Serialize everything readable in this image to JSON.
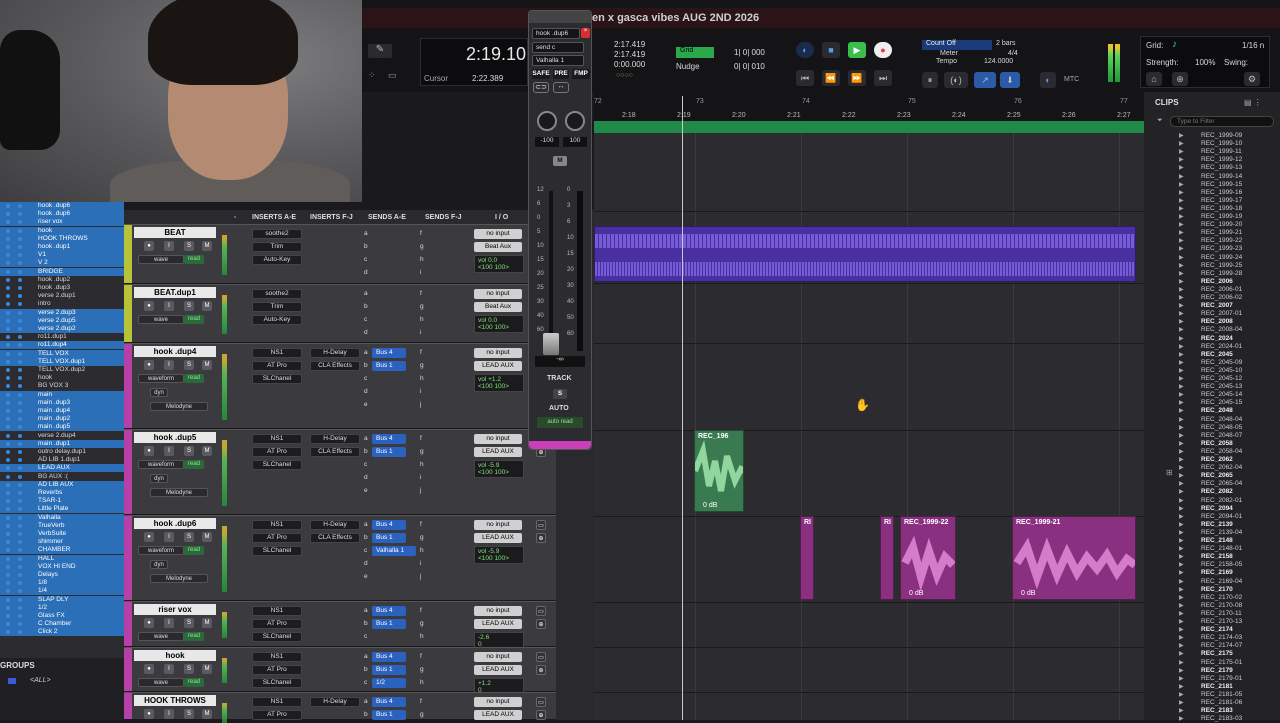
{
  "session": {
    "title": "en x gasca vibes AUG 2ND 2026"
  },
  "transport": {
    "counter_main": "2:19.10",
    "cursor_label": "Cursor",
    "cursor_value": "2:22.389",
    "sel_start": "2:17.419",
    "sel_end": "2:17.419",
    "sel_length": "0:00.000",
    "grid_label": "Grid",
    "grid_value": "1| 0| 000",
    "nudge_label": "Nudge",
    "nudge_value": "0| 0| 010",
    "count_off": "Count Off",
    "count_off_value": "2 bars",
    "meter_label": "Meter",
    "meter_value": "4/4",
    "tempo_label": "Tempo",
    "tempo_value": "124.0000",
    "mtc": "MTC",
    "grid2_label": "Grid:",
    "grid2_value": "1/16 n",
    "strength_label": "Strength:",
    "strength_value": "100%",
    "swing_label": "Swing:"
  },
  "ruler": {
    "bars": [
      "72",
      "73",
      "74",
      "75",
      "76",
      "77"
    ],
    "times": [
      "2:18",
      "2:19",
      "2:20",
      "2:21",
      "2:22",
      "2:23",
      "2:24",
      "2:25",
      "2:26",
      "2:27"
    ]
  },
  "tracks_list": [
    {
      "name": "hook .dup6",
      "hl": true
    },
    {
      "name": "hook .dup6",
      "hl": true
    },
    {
      "name": "riser vox",
      "hl": true
    },
    {
      "name": "hook",
      "hl": true
    },
    {
      "name": "HOOK THROWS",
      "hl": true
    },
    {
      "name": "hook .dup1",
      "hl": true
    },
    {
      "name": "V1",
      "hl": true
    },
    {
      "name": "V 2",
      "hl": true
    },
    {
      "name": "BRIDGE",
      "hl": true
    },
    {
      "name": "hook .dup2",
      "hl": false
    },
    {
      "name": "hook .dup3",
      "hl": false
    },
    {
      "name": "verse 2.dup1",
      "hl": false
    },
    {
      "name": "intro",
      "hl": false
    },
    {
      "name": "verse 2.dup3",
      "hl": true
    },
    {
      "name": "verse 2.dup5",
      "hl": true
    },
    {
      "name": "verse 2.dup2",
      "hl": true
    },
    {
      "name": "ro11.dup1",
      "hl": false
    },
    {
      "name": "ro11.dup4",
      "hl": true
    },
    {
      "name": "TELL VOX",
      "hl": true
    },
    {
      "name": "TELL VOX.dup1",
      "hl": true
    },
    {
      "name": "TELL VOX.dup2",
      "hl": false
    },
    {
      "name": "hook",
      "hl": false
    },
    {
      "name": "BG VOX 3",
      "hl": false
    },
    {
      "name": "main",
      "hl": true
    },
    {
      "name": "main .dup3",
      "hl": true
    },
    {
      "name": "main .dup4",
      "hl": true
    },
    {
      "name": "main .dup2",
      "hl": true
    },
    {
      "name": "main .dup5",
      "hl": true
    },
    {
      "name": "verse 2.dup4",
      "hl": false
    },
    {
      "name": "main .dup1",
      "hl": true
    },
    {
      "name": "outro delay.dup1",
      "hl": false
    },
    {
      "name": "AD LIB 1.dup1",
      "hl": false
    },
    {
      "name": "LEAD AUX",
      "hl": true
    },
    {
      "name": "BG AUX :(",
      "hl": false
    },
    {
      "name": "AD LIB AUX",
      "hl": true
    },
    {
      "name": "Reverbs",
      "hl": true
    },
    {
      "name": "TSAR-1",
      "hl": true
    },
    {
      "name": "Little Plate",
      "hl": true
    },
    {
      "name": "Valhalla",
      "hl": true
    },
    {
      "name": "TrueVerb",
      "hl": true
    },
    {
      "name": "VerbSuite",
      "hl": true
    },
    {
      "name": "shimmer",
      "hl": true
    },
    {
      "name": "CHAMBER",
      "hl": true
    },
    {
      "name": "HALL",
      "hl": true
    },
    {
      "name": "VOX HI END",
      "hl": true
    },
    {
      "name": "Delays",
      "hl": true
    },
    {
      "name": "1/8",
      "hl": true
    },
    {
      "name": "1/4",
      "hl": true
    },
    {
      "name": "SLAP DLY",
      "hl": true
    },
    {
      "name": "1/2",
      "hl": true
    },
    {
      "name": "Glass FX",
      "hl": true
    },
    {
      "name": "C Chamber",
      "hl": true
    },
    {
      "name": "Click 2",
      "hl": true
    }
  ],
  "groups": {
    "label": "GROUPS",
    "all": "<ALL>"
  },
  "mix_headers": {
    "inserts_ae": "INSERTS A-E",
    "inserts_fj": "INSERTS F-J",
    "sends_ae": "SENDS A-E",
    "sends_fj": "SENDS F-J",
    "io": "I / O"
  },
  "mix_tracks": [
    {
      "name": "BEAT",
      "ins1": [
        "soothe2",
        "Trim",
        "Auto-Key"
      ],
      "ins2": [],
      "sends": [],
      "io_in": "no input",
      "io_out": "Beat Aux",
      "vol": "vol 0.0",
      "pan": "<100   100>",
      "mode": "wave",
      "auto": "read",
      "dyn": false,
      "color": "#b7c43a"
    },
    {
      "name": "BEAT.dup1",
      "ins1": [
        "soothe2",
        "Trim",
        "Auto-Key"
      ],
      "ins2": [],
      "sends": [],
      "io_in": "no input",
      "io_out": "Beat Aux",
      "vol": "vol 0.0",
      "pan": "<100   100>",
      "mode": "wave",
      "auto": "read",
      "dyn": false,
      "color": "#b7c43a"
    },
    {
      "name": "hook .dup4",
      "ins1": [
        "NS1",
        "AT Pro",
        "SLChanel"
      ],
      "ins2": [
        "H-Delay",
        "CLA Effects"
      ],
      "sends": [
        "Bus 4",
        "Bus 1"
      ],
      "io_in": "no input",
      "io_out": "LEAD AUX",
      "vol": "vol +1.2",
      "pan": "<100   100>",
      "mode": "waveform",
      "auto": "read",
      "dyn": true,
      "plugin": "Melodyne",
      "color": "#b640a8"
    },
    {
      "name": "hook .dup5",
      "ins1": [
        "NS1",
        "AT Pro",
        "SLChanel"
      ],
      "ins2": [
        "H-Delay",
        "CLA Effects"
      ],
      "sends": [
        "Bus 4",
        "Bus 1"
      ],
      "io_in": "no input",
      "io_out": "LEAD AUX",
      "vol": "vol -5.9",
      "pan": "<100   100>",
      "mode": "waveform",
      "auto": "read",
      "dyn": true,
      "plugin": "Melodyne",
      "color": "#b640a8"
    },
    {
      "name": "hook .dup6",
      "ins1": [
        "NS1",
        "AT Pro",
        "SLChanel"
      ],
      "ins2": [
        "H-Delay",
        "CLA Effects"
      ],
      "sends": [
        "Bus 4",
        "Bus 1",
        "Valhalla 1"
      ],
      "io_in": "no input",
      "io_out": "LEAD AUX",
      "vol": "vol -5.9",
      "pan": "<100   100>",
      "mode": "waveform",
      "auto": "read",
      "dyn": true,
      "plugin": "Melodyne",
      "color": "#b640a8"
    },
    {
      "name": "riser vox",
      "ins1": [
        "NS1",
        "AT Pro",
        "SLChanel"
      ],
      "ins2": [],
      "sends": [
        "Bus 4",
        "Bus 1"
      ],
      "io_in": "no input",
      "io_out": "LEAD AUX",
      "vol": "-2.6",
      "pan": "0",
      "mode": "wave",
      "auto": "read",
      "dyn": false,
      "color": "#b640a8"
    },
    {
      "name": "hook",
      "ins1": [
        "NS1",
        "AT Pro",
        "SLChanel"
      ],
      "ins2": [],
      "sends": [
        "Bus 4",
        "Bus 1",
        "1/2"
      ],
      "io_in": "no input",
      "io_out": "LEAD AUX",
      "vol": "+1.2",
      "pan": "0",
      "mode": "wave",
      "auto": "read",
      "dyn": false,
      "color": "#b640a8"
    },
    {
      "name": "HOOK THROWS",
      "ins1": [
        "NS1",
        "AT Pro"
      ],
      "ins2": [
        "H-Delay"
      ],
      "sends": [
        "Bus 4",
        "Bus 1"
      ],
      "io_in": "no input",
      "io_out": "LEAD AUX",
      "vol": "",
      "pan": "",
      "mode": "wave",
      "auto": "read",
      "dyn": false,
      "color": "#b640a8"
    }
  ],
  "channel_strip": {
    "track": "hook .dup6",
    "send": "send c",
    "plugin": "Valhalla 1",
    "safe": "SAFE",
    "pre": "PRE",
    "fmp": "FMP",
    "pan_l": "-100",
    "pan_r": "100",
    "m": "M",
    "vol": "-∞",
    "track_label": "TRACK",
    "s": "S",
    "auto_label": "AUTO",
    "auto_mode": "auto read",
    "scale": [
      "12",
      "6",
      "0",
      "5",
      "10",
      "15",
      "20",
      "25",
      "30",
      "40",
      "60"
    ],
    "meter_scale": [
      "0",
      "3",
      "6",
      "10",
      "15",
      "20",
      "30",
      "40",
      "50",
      "60"
    ]
  },
  "clips_panel": {
    "header": "CLIPS",
    "filter_placeholder": "Type to Filter",
    "items": [
      {
        "name": "REC_1999-09",
        "bold": false
      },
      {
        "name": "REC_1999-10",
        "bold": false
      },
      {
        "name": "REC_1999-11",
        "bold": false
      },
      {
        "name": "REC_1999-12",
        "bold": false
      },
      {
        "name": "REC_1999-13",
        "bold": false
      },
      {
        "name": "REC_1999-14",
        "bold": false
      },
      {
        "name": "REC_1999-15",
        "bold": false
      },
      {
        "name": "REC_1999-16",
        "bold": false
      },
      {
        "name": "REC_1999-17",
        "bold": false
      },
      {
        "name": "REC_1999-18",
        "bold": false
      },
      {
        "name": "REC_1999-19",
        "bold": false
      },
      {
        "name": "REC_1999-20",
        "bold": false
      },
      {
        "name": "REC_1999-21",
        "bold": false
      },
      {
        "name": "REC_1999-22",
        "bold": false
      },
      {
        "name": "REC_1999-23",
        "bold": false
      },
      {
        "name": "REC_1999-24",
        "bold": false
      },
      {
        "name": "REC_1999-25",
        "bold": false
      },
      {
        "name": "REC_1999-28",
        "bold": false
      },
      {
        "name": "REC_2006",
        "bold": true
      },
      {
        "name": "REC_2006-01",
        "bold": false
      },
      {
        "name": "REC_2006-02",
        "bold": false
      },
      {
        "name": "REC_2007",
        "bold": true
      },
      {
        "name": "REC_2007-01",
        "bold": false
      },
      {
        "name": "REC_2008",
        "bold": true
      },
      {
        "name": "REC_2008-04",
        "bold": false
      },
      {
        "name": "REC_2024",
        "bold": true
      },
      {
        "name": "REC_2024-01",
        "bold": false
      },
      {
        "name": "REC_2045",
        "bold": true
      },
      {
        "name": "REC_2045-09",
        "bold": false
      },
      {
        "name": "REC_2045-10",
        "bold": false
      },
      {
        "name": "REC_2045-12",
        "bold": false
      },
      {
        "name": "REC_2045-13",
        "bold": false
      },
      {
        "name": "REC_2045-14",
        "bold": false
      },
      {
        "name": "REC_2045-15",
        "bold": false
      },
      {
        "name": "REC_2048",
        "bold": true
      },
      {
        "name": "REC_2048-04",
        "bold": false
      },
      {
        "name": "REC_2048-05",
        "bold": false
      },
      {
        "name": "REC_2048-07",
        "bold": false
      },
      {
        "name": "REC_2058",
        "bold": true
      },
      {
        "name": "REC_2058-04",
        "bold": false
      },
      {
        "name": "REC_2062",
        "bold": true
      },
      {
        "name": "REC_2062-04",
        "bold": false
      },
      {
        "name": "REC_2065",
        "bold": true
      },
      {
        "name": "REC_2065-04",
        "bold": false
      },
      {
        "name": "REC_2082",
        "bold": true
      },
      {
        "name": "REC_2082-01",
        "bold": false
      },
      {
        "name": "REC_2094",
        "bold": true
      },
      {
        "name": "REC_2094-01",
        "bold": false
      },
      {
        "name": "REC_2139",
        "bold": true
      },
      {
        "name": "REC_2139-04",
        "bold": false
      },
      {
        "name": "REC_2148",
        "bold": true
      },
      {
        "name": "REC_2148-01",
        "bold": false
      },
      {
        "name": "REC_2158",
        "bold": true
      },
      {
        "name": "REC_2158-05",
        "bold": false
      },
      {
        "name": "REC_2169",
        "bold": true
      },
      {
        "name": "REC_2169-04",
        "bold": false
      },
      {
        "name": "REC_2170",
        "bold": true
      },
      {
        "name": "REC_2170-02",
        "bold": false
      },
      {
        "name": "REC_2170-08",
        "bold": false
      },
      {
        "name": "REC_2170-11",
        "bold": false
      },
      {
        "name": "REC_2170-13",
        "bold": false
      },
      {
        "name": "REC_2174",
        "bold": true
      },
      {
        "name": "REC_2174-03",
        "bold": false
      },
      {
        "name": "REC_2174-07",
        "bold": false
      },
      {
        "name": "REC_2175",
        "bold": true
      },
      {
        "name": "REC_2175-01",
        "bold": false
      },
      {
        "name": "REC_2179",
        "bold": true
      },
      {
        "name": "REC_2179-01",
        "bold": false
      },
      {
        "name": "REC_2181",
        "bold": true
      },
      {
        "name": "REC_2181-05",
        "bold": false
      },
      {
        "name": "REC_2181-06",
        "bold": false
      },
      {
        "name": "REC_2183",
        "bold": true
      },
      {
        "name": "REC_2183-03",
        "bold": false
      }
    ]
  },
  "clips": [
    {
      "name": "REC_196",
      "gain": "0 dB"
    },
    {
      "name": "RI",
      "gain": ""
    },
    {
      "name": "RI",
      "gain": ""
    },
    {
      "name": "RI",
      "gain": ""
    },
    {
      "name": "REC_1999-22",
      "gain": "0 dB"
    },
    {
      "name": "REC_1999-21",
      "gain": "0 dB"
    }
  ],
  "colors": {
    "beat": "#6a4bd0",
    "hook_green": "#58b070",
    "hook_pink": "#c050b8",
    "marker": "#1f8a4a"
  }
}
